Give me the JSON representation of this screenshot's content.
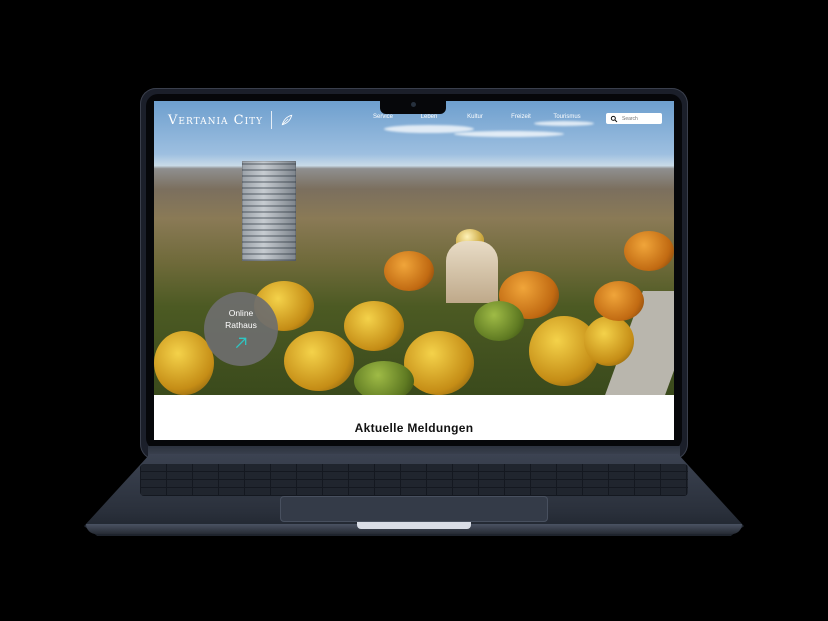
{
  "brand": {
    "name": "Vertania City"
  },
  "nav": {
    "items": [
      {
        "label": "Service"
      },
      {
        "label": "Leben"
      },
      {
        "label": "Kultur"
      },
      {
        "label": "Freizeit"
      },
      {
        "label": "Tourismus"
      }
    ]
  },
  "search": {
    "placeholder": "Search",
    "icon": "search-icon"
  },
  "online_rathaus": {
    "line1": "Online",
    "line2": "Rathaus",
    "icon": "arrow-up-right-icon",
    "accent": "#2ec6c3"
  },
  "news": {
    "heading": "Aktuelle Meldungen"
  }
}
